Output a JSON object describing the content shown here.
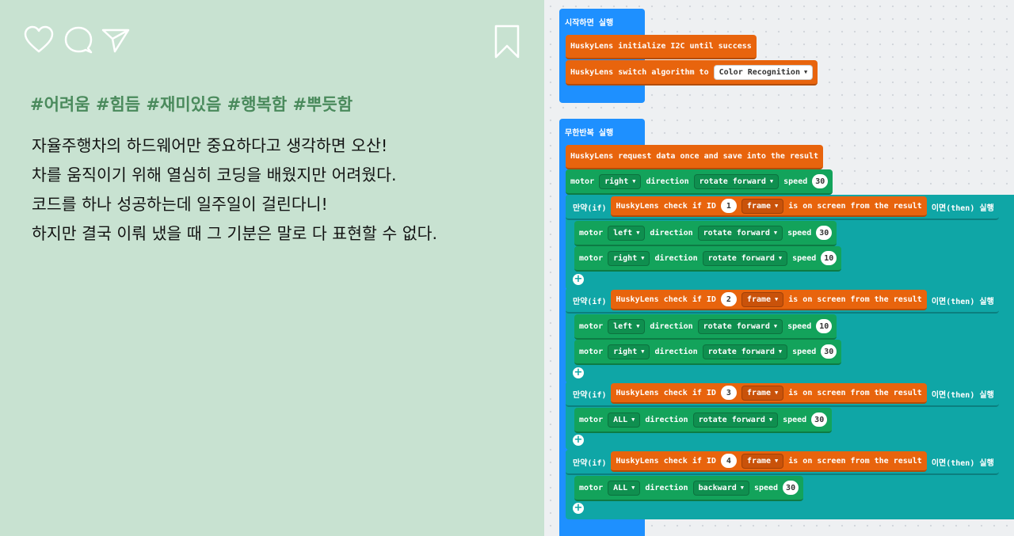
{
  "post": {
    "hashtags": "#어려움 #힘듬 #재미있음 #행복함 #뿌듯함",
    "lines": [
      "자율주행차의 하드웨어만 중요하다고 생각하면 오산!",
      "차를 움직이기 위해 열심히 코딩을 배웠지만 어려웠다.",
      "코드를 하나 성공하는데 일주일이 걸린다니!",
      "하지만 결국 이뤄 냈을 때 그 기분은 말로 다 표현할 수 없다."
    ]
  },
  "icons": {
    "like": "heart-icon",
    "comment": "comment-bubble-icon",
    "share": "paper-plane-icon",
    "save": "bookmark-icon"
  },
  "colors": {
    "panel_bg": "#c8e2d1",
    "hashtag": "#4a8a5c",
    "block_blue": "#1e90ff",
    "block_orange": "#e8640d",
    "block_green": "#13a35b",
    "block_teal": "#0fa6a6"
  },
  "code": {
    "on_start": {
      "label": "시작하면 실행",
      "init_block": "HuskyLens initialize I2C until success",
      "switch_block": "HuskyLens switch algorithm to",
      "algorithm": "Color Recognition"
    },
    "forever": {
      "label": "무한반복 실행",
      "request_block": "HuskyLens request data once and save into the result",
      "motor_word": "motor",
      "direction_word": "direction",
      "speed_word": "speed",
      "top_motor": {
        "motor": "right",
        "direction": "rotate forward",
        "speed": "30"
      },
      "if_label": "만약(if)",
      "then_label": "이면(then) 실행",
      "check_prefix": "HuskyLens check if ID",
      "frame": "frame",
      "check_suffix": "is on screen from the result",
      "ifs": [
        {
          "id": "1",
          "motors": [
            {
              "motor": "left",
              "direction": "rotate forward",
              "speed": "30"
            },
            {
              "motor": "right",
              "direction": "rotate forward",
              "speed": "10"
            }
          ]
        },
        {
          "id": "2",
          "motors": [
            {
              "motor": "left",
              "direction": "rotate forward",
              "speed": "10"
            },
            {
              "motor": "right",
              "direction": "rotate forward",
              "speed": "30"
            }
          ]
        },
        {
          "id": "3",
          "motors": [
            {
              "motor": "ALL",
              "direction": "rotate forward",
              "speed": "30"
            }
          ]
        },
        {
          "id": "4",
          "motors": [
            {
              "motor": "ALL",
              "direction": "backward",
              "speed": "30"
            }
          ]
        }
      ]
    }
  }
}
